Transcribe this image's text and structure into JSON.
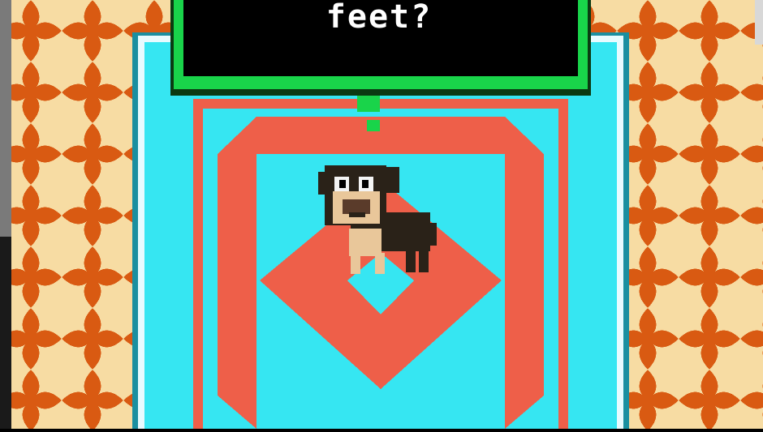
{
  "dialog": {
    "text": "feet?"
  },
  "colors": {
    "wallpaper": "#f7dca3",
    "petal": "#d95a12",
    "rug_border": "#36e6f2",
    "rug_red": "#ee5f49",
    "dialog_border": "#19d44a",
    "dialog_fill": "#000000"
  },
  "sprites": {
    "character": "pug-dog"
  }
}
